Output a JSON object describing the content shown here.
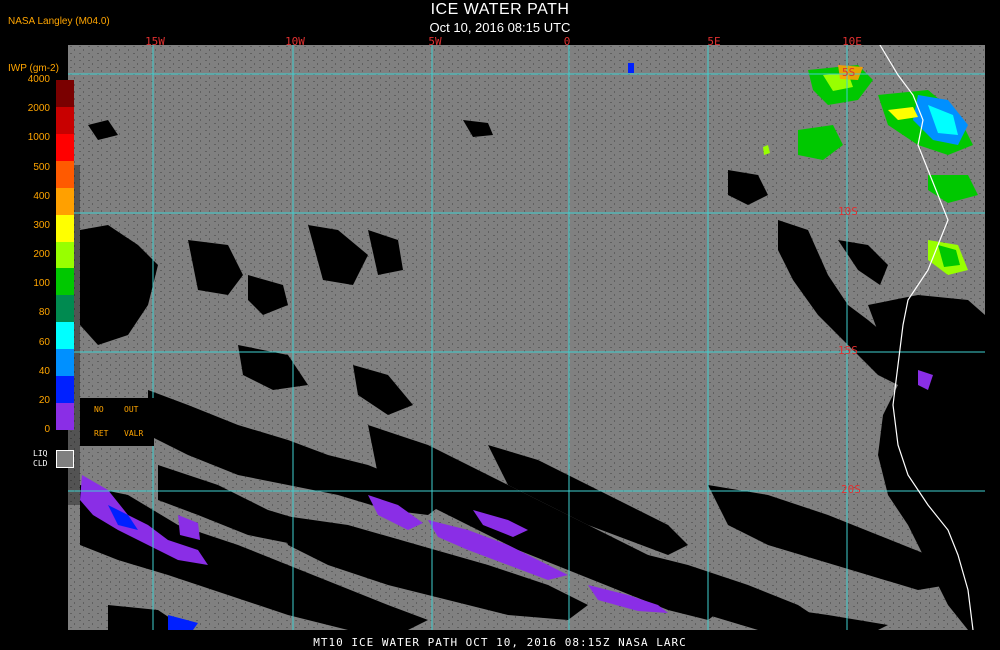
{
  "header": {
    "title": "ICE WATER PATH",
    "subtitle": "Oct 10, 2016 08:15 UTC",
    "producer": "NASA Langley (M04.0)"
  },
  "map": {
    "longitude_labels": [
      "15W",
      "10W",
      "5W",
      "0",
      "5E",
      "10E"
    ],
    "latitude_labels": [
      "5S",
      "10S",
      "15S",
      "20S"
    ],
    "colors": {
      "background": "#000000",
      "liquid_cloud": "#808080",
      "clear": "#000000",
      "grid": "#3fd0d0",
      "grid_labels": "#e03030",
      "coastline": "#ffffff"
    }
  },
  "legend": {
    "title": "IWP (gm-2)",
    "ticks": [
      "4000",
      "2000",
      "1000",
      "500",
      "400",
      "300",
      "200",
      "100",
      "80",
      "60",
      "40",
      "20",
      "0"
    ],
    "colors": [
      "#7a0000",
      "#c80000",
      "#ff0000",
      "#ff5a00",
      "#ffa000",
      "#ffff00",
      "#98ff00",
      "#00c800",
      "#008a50",
      "#00ffff",
      "#0090ff",
      "#0020ff",
      "#8a2ee6"
    ],
    "no_retrieval": [
      "NO",
      "RET"
    ],
    "out_of_range": [
      "OUT",
      "VALR"
    ],
    "liquid_cloud_label": [
      "LIQ",
      "CLD"
    ]
  },
  "footer": {
    "text": "MT10  ICE WATER PATH   OCT 10, 2016 08:15Z   NASA LARC"
  }
}
